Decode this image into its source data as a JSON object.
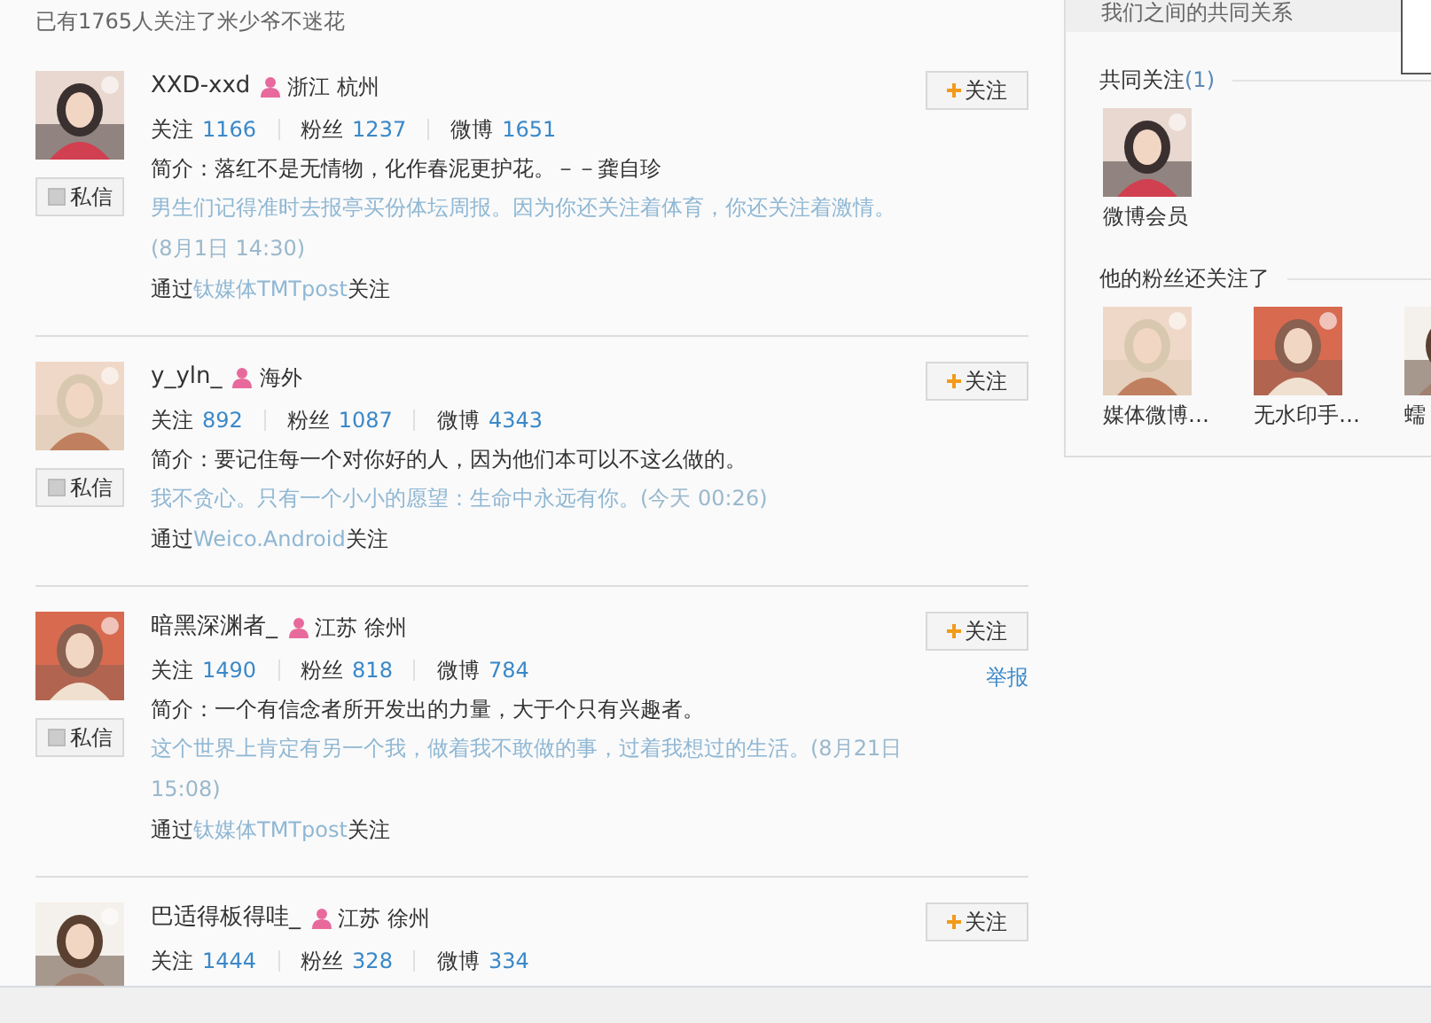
{
  "header": {
    "text": "已有1765人关注了米少爷不迷花"
  },
  "fans": [
    {
      "name": "XXD-xxd",
      "location": "浙江 杭州",
      "stats": [
        {
          "label": "关注",
          "value": "1166"
        },
        {
          "label": "粉丝",
          "value": "1237"
        },
        {
          "label": "微博",
          "value": "1651"
        }
      ],
      "intro": "简介：落红不是无情物，化作春泥更护花。－－龚自珍",
      "status": "男生们记得准时去报亭买份体坛周报。因为你还关注着体育，你还关注着激情。",
      "time": "(8月1日 14:30)",
      "via": {
        "prefix": "通过",
        "source": "钛媒体TMTpost",
        "suffix": "关注"
      },
      "follow": "关注",
      "message": "私信"
    },
    {
      "name": "y_yln_",
      "location": "海外",
      "stats": [
        {
          "label": "关注",
          "value": "892"
        },
        {
          "label": "粉丝",
          "value": "1087"
        },
        {
          "label": "微博",
          "value": "4343"
        }
      ],
      "intro": "简介：要记住每一个对你好的人，因为他们本可以不这么做的。",
      "status": "我不贪心。只有一个小小的愿望：生命中永远有你。",
      "time": "(今天 00:26)",
      "via": {
        "prefix": "通过",
        "source": "Weico.Android",
        "suffix": "关注"
      },
      "follow": "关注",
      "message": "私信"
    },
    {
      "name": "暗黑深渊者_",
      "location": "江苏 徐州",
      "stats": [
        {
          "label": "关注",
          "value": "1490"
        },
        {
          "label": "粉丝",
          "value": "818"
        },
        {
          "label": "微博",
          "value": "784"
        }
      ],
      "intro": "简介：一个有信念者所开发出的力量，大于个只有兴趣者。",
      "status": "这个世界上肯定有另一个我，做着我不敢做的事，过着我想过的生活。",
      "time": "(8月21日 15:08)",
      "via": {
        "prefix": "通过",
        "source": "钛媒体TMTpost",
        "suffix": "关注"
      },
      "follow": "关注",
      "message": "私信",
      "report": "举报"
    },
    {
      "name": "巴适得板得哇_",
      "location": "江苏 徐州",
      "stats": [
        {
          "label": "关注",
          "value": "1444"
        },
        {
          "label": "粉丝",
          "value": "328"
        },
        {
          "label": "微博",
          "value": "334"
        }
      ],
      "follow": "关注"
    }
  ],
  "sidebar": {
    "header": "我们之间的共同关系",
    "sections": [
      {
        "title": "共同关注",
        "count": "(1)",
        "items": [
          {
            "name": "微博会员"
          }
        ]
      },
      {
        "title": "他的粉丝还关注了",
        "items": [
          {
            "name": "媒体微博…"
          },
          {
            "name": "无水印手…"
          },
          {
            "name": "蠕"
          }
        ]
      }
    ]
  }
}
